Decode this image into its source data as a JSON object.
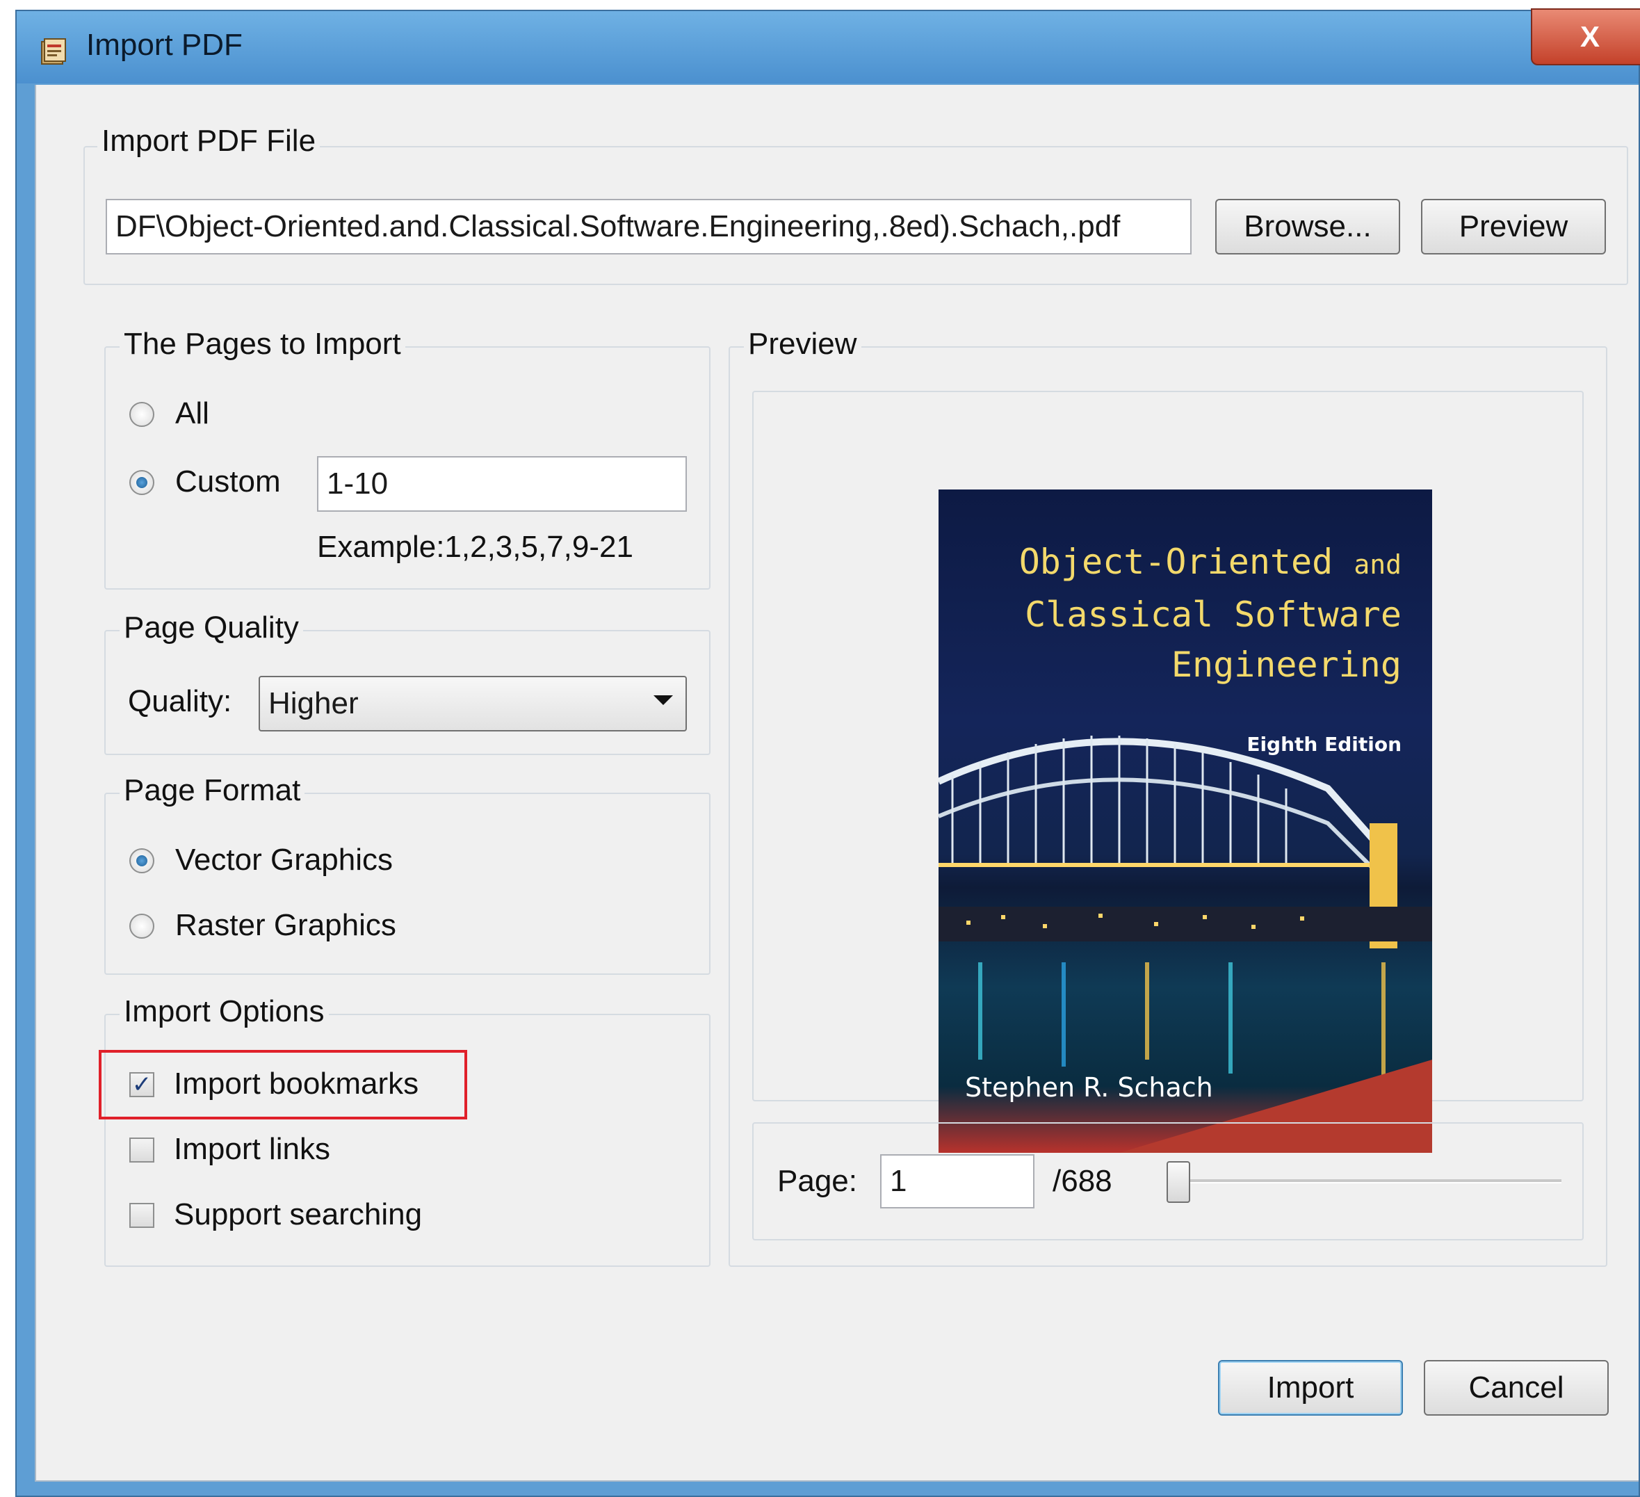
{
  "window": {
    "title": "Import PDF",
    "close_label": "X"
  },
  "file_group": {
    "label": "Import PDF File",
    "path_value": "DF\\Object-Oriented.and.Classical.Software.Engineering,.8ed).Schach,.pdf",
    "browse_label": "Browse...",
    "preview_label": "Preview"
  },
  "pages_group": {
    "label": "The Pages to Import",
    "all_label": "All",
    "custom_label": "Custom",
    "custom_value": "1-10",
    "example_text": "Example:1,2,3,5,7,9-21",
    "selected": "custom"
  },
  "quality_group": {
    "label": "Page Quality",
    "quality_label": "Quality:",
    "quality_value": "Higher"
  },
  "format_group": {
    "label": "Page Format",
    "vector_label": "Vector Graphics",
    "raster_label": "Raster Graphics",
    "selected": "vector"
  },
  "options_group": {
    "label": "Import Options",
    "bookmarks_label": "Import bookmarks",
    "bookmarks_checked": true,
    "links_label": "Import links",
    "links_checked": false,
    "searching_label": "Support searching",
    "searching_checked": false,
    "highlight_color": "#e0202a"
  },
  "preview_group": {
    "label": "Preview",
    "cover": {
      "title_line1": "Object-Oriented",
      "title_and": "and",
      "title_line2": "Classical Software",
      "title_line3": "Engineering",
      "edition": "Eighth Edition",
      "author": "Stephen R. Schach"
    },
    "page_label": "Page:",
    "page_value": "1",
    "page_total": "/688",
    "slider_position": 0.0
  },
  "footer": {
    "import_label": "Import",
    "cancel_label": "Cancel"
  },
  "colors": {
    "titlebar": "#4b90cf",
    "client_bg": "#f0f0f0",
    "close_button": "#c4412a"
  }
}
